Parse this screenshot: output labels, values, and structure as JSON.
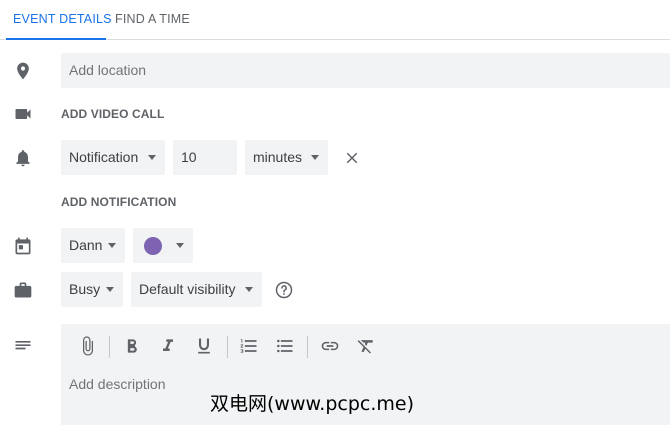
{
  "tabs": [
    {
      "label": "EVENT DETAILS",
      "active": true
    },
    {
      "label": "FIND A TIME",
      "active": false
    }
  ],
  "location": {
    "placeholder": "Add location"
  },
  "video_call": {
    "label": "ADD VIDEO CALL"
  },
  "notification": {
    "type": "Notification",
    "amount": "10",
    "unit": "minutes",
    "add_label": "ADD NOTIFICATION"
  },
  "calendar": {
    "name": "Dann",
    "color": "#7d63b1"
  },
  "availability": {
    "status": "Busy",
    "visibility": "Default visibility"
  },
  "description": {
    "placeholder": "Add description"
  },
  "toolbar": {
    "items": [
      "attachment-icon",
      "bold-icon",
      "italic-icon",
      "underline-icon",
      "numbered-list-icon",
      "bulleted-list-icon",
      "link-icon",
      "remove-formatting-icon"
    ]
  },
  "colors": {
    "accent": "#1a73e8",
    "field_bg": "#f1f3f4",
    "icon": "#5f6368"
  },
  "watermark": "双电网(www.pcpc.me)"
}
